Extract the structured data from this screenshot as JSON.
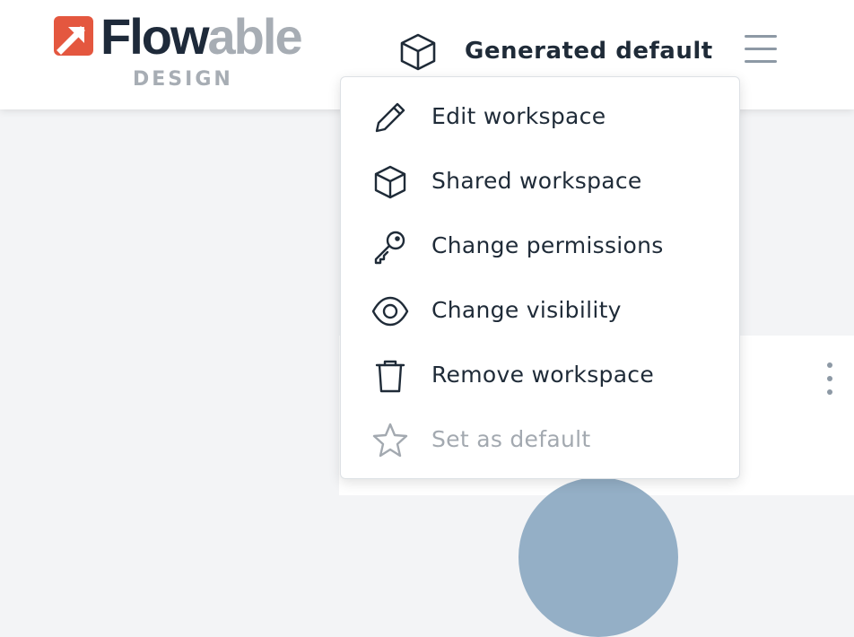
{
  "brand": {
    "word_dark": "Flow",
    "word_light": "able",
    "subtitle": "DESIGN",
    "colors": {
      "mark": "#e4573f",
      "dark": "#1e2a3a",
      "light": "#a7adb4"
    }
  },
  "header": {
    "workspace_icon": "cube-icon",
    "workspace_name": "Generated default",
    "menu_icon": "hamburger-menu-icon"
  },
  "workspace_menu": {
    "items": [
      {
        "label": "Edit workspace",
        "icon": "pencil-icon",
        "enabled": true
      },
      {
        "label": "Shared workspace",
        "icon": "cube-icon",
        "enabled": true
      },
      {
        "label": "Change permissions",
        "icon": "key-icon",
        "enabled": true
      },
      {
        "label": "Change visibility",
        "icon": "eye-icon",
        "enabled": true
      },
      {
        "label": "Remove workspace",
        "icon": "trash-icon",
        "enabled": true
      },
      {
        "label": "Set as default",
        "icon": "star-icon",
        "enabled": false
      }
    ]
  },
  "content": {
    "card_menu_icon": "kebab-menu-icon"
  }
}
